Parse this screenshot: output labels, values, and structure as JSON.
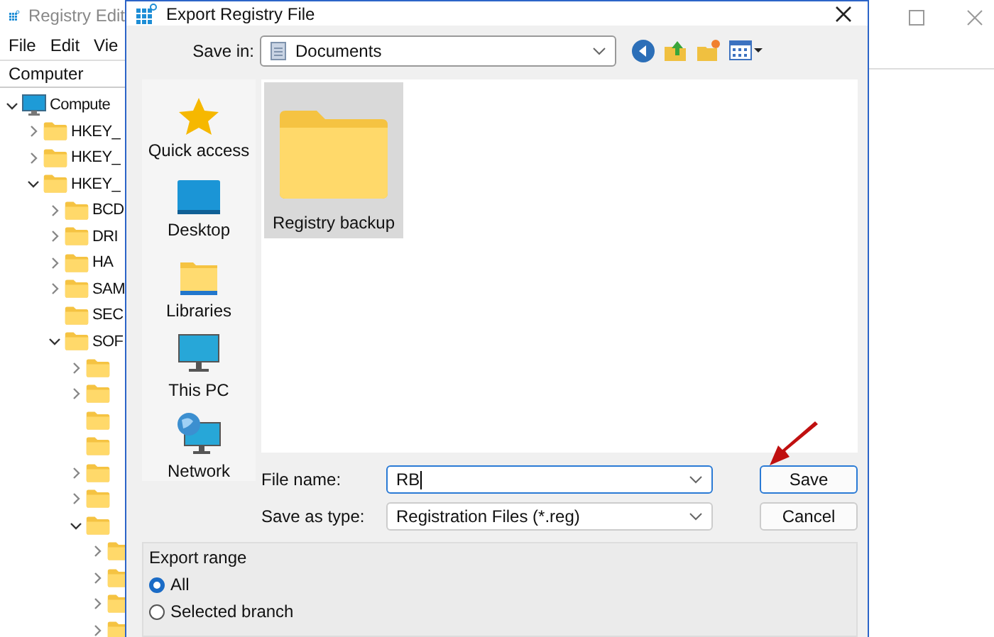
{
  "regedit": {
    "title": "Registry Edit",
    "menu": [
      "File",
      "Edit",
      "Vie"
    ],
    "address": "Computer",
    "tree": [
      {
        "kind": "branch",
        "label": "Compute",
        "expanded": true,
        "children": [
          {
            "kind": "branch",
            "label": "HKEY_",
            "expanded": false
          },
          {
            "kind": "branch",
            "label": "HKEY_",
            "expanded": false
          },
          {
            "kind": "branch",
            "label": "HKEY_",
            "expanded": true,
            "children": [
              {
                "kind": "branch",
                "label": "BCD",
                "expanded": false
              },
              {
                "kind": "branch",
                "label": "DRI",
                "expanded": false
              },
              {
                "kind": "branch",
                "label": "HA",
                "expanded": false
              },
              {
                "kind": "branch",
                "label": "SAM",
                "expanded": false
              },
              {
                "kind": "leaf",
                "label": "SEC"
              },
              {
                "kind": "branch",
                "label": "SOF",
                "expanded": true,
                "children": [
                  {
                    "kind": "branch",
                    "expanded": false
                  },
                  {
                    "kind": "branch",
                    "expanded": false
                  },
                  {
                    "kind": "leaf"
                  },
                  {
                    "kind": "leaf"
                  },
                  {
                    "kind": "branch",
                    "expanded": false
                  },
                  {
                    "kind": "branch",
                    "expanded": false
                  },
                  {
                    "kind": "branch",
                    "expanded": true,
                    "children": [
                      {
                        "kind": "branch",
                        "expanded": false
                      },
                      {
                        "kind": "branch",
                        "expanded": false
                      },
                      {
                        "kind": "branch",
                        "expanded": false
                      },
                      {
                        "kind": "branch",
                        "expanded": false
                      }
                    ]
                  }
                ]
              }
            ]
          }
        ]
      }
    ]
  },
  "dialog": {
    "title": "Export Registry File",
    "save_in": {
      "label": "Save in:",
      "value": "Documents"
    },
    "places": [
      {
        "kind": "star",
        "label": "Quick access"
      },
      {
        "kind": "desktop",
        "label": "Desktop"
      },
      {
        "kind": "libraries",
        "label": "Libraries"
      },
      {
        "kind": "pc",
        "label": "This PC"
      },
      {
        "kind": "network",
        "label": "Network"
      }
    ],
    "files": [
      {
        "name": "Registry backup",
        "selected": true
      }
    ],
    "file_name": {
      "label": "File name:",
      "value": "RB"
    },
    "save_as_type": {
      "label": "Save as type:",
      "value": "Registration Files (*.reg)"
    },
    "buttons": [
      "Save",
      "Cancel"
    ],
    "export_range": {
      "label": "Export range",
      "options": [
        {
          "label": "All",
          "selected": true
        },
        {
          "label": "Selected branch",
          "selected": false
        }
      ]
    }
  }
}
